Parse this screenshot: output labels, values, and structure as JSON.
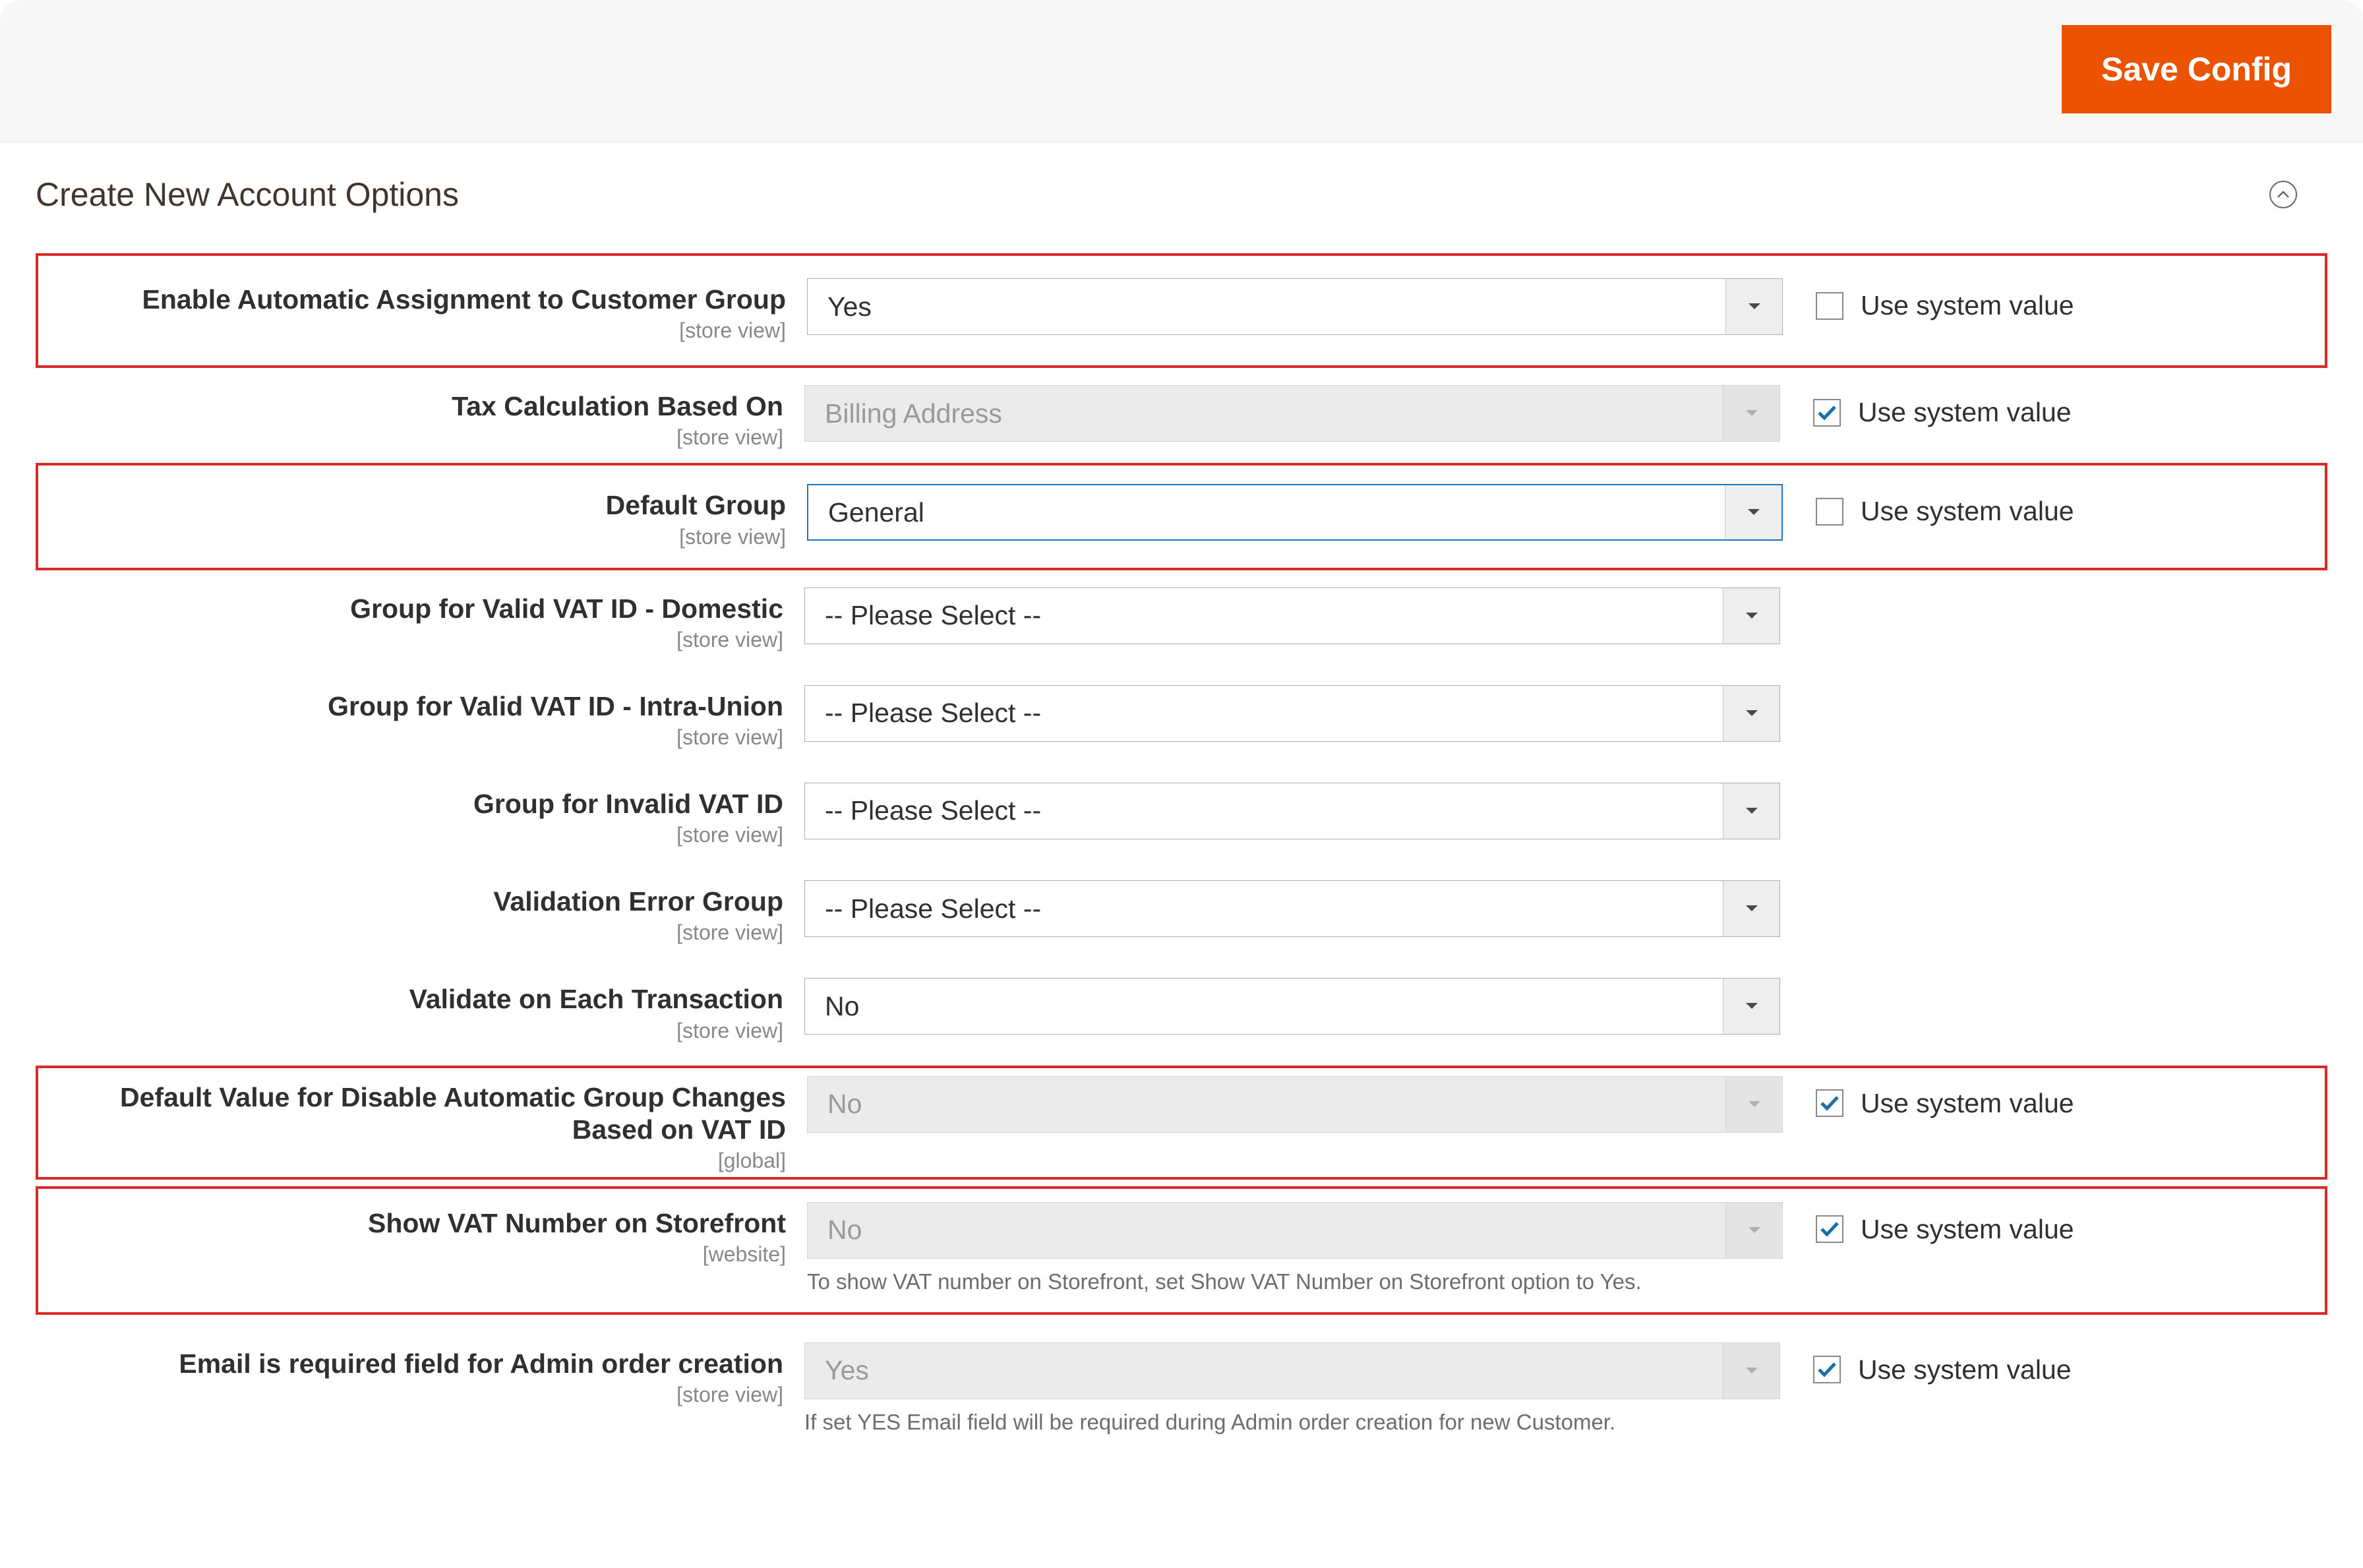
{
  "header": {
    "save_config": "Save Config"
  },
  "section": {
    "title": "Create New Account Options"
  },
  "common": {
    "use_system_value": "Use system value"
  },
  "rows": {
    "r0": {
      "label": "Enable Automatic Assignment to Customer Group",
      "scope": "[store view]",
      "value": "Yes",
      "disabled": false,
      "checked": false,
      "highlight": true,
      "blue": false
    },
    "r1": {
      "label": "Tax Calculation Based On",
      "scope": "[store view]",
      "value": "Billing Address",
      "disabled": true,
      "checked": true,
      "highlight": false,
      "blue": false
    },
    "r2": {
      "label": "Default Group",
      "scope": "[store view]",
      "value": "General",
      "disabled": false,
      "checked": false,
      "highlight": true,
      "blue": true
    },
    "r3": {
      "label": "Group for Valid VAT ID - Domestic",
      "scope": "[store view]",
      "value": "-- Please Select --",
      "disabled": false,
      "checked": false,
      "highlight": false,
      "blue": false
    },
    "r4": {
      "label": "Group for Valid VAT ID - Intra-Union",
      "scope": "[store view]",
      "value": "-- Please Select --",
      "disabled": false,
      "checked": false,
      "highlight": false,
      "blue": false
    },
    "r5": {
      "label": "Group for Invalid VAT ID",
      "scope": "[store view]",
      "value": "-- Please Select --",
      "disabled": false,
      "checked": false,
      "highlight": false,
      "blue": false
    },
    "r6": {
      "label": "Validation Error Group",
      "scope": "[store view]",
      "value": "-- Please Select --",
      "disabled": false,
      "checked": false,
      "highlight": false,
      "blue": false
    },
    "r7": {
      "label": "Validate on Each Transaction",
      "scope": "[store view]",
      "value": "No",
      "disabled": false,
      "checked": false,
      "highlight": false,
      "blue": false
    },
    "r8": {
      "label": "Default Value for Disable Automatic Group Changes Based on VAT ID",
      "scope": "[global]",
      "value": "No",
      "disabled": true,
      "checked": true,
      "highlight": true,
      "blue": false
    },
    "r9": {
      "label": "Show VAT Number on Storefront",
      "scope": "[website]",
      "value": "No",
      "disabled": true,
      "checked": true,
      "highlight": true,
      "blue": false,
      "hint": "To show VAT number on Storefront, set Show VAT Number on Storefront option to Yes."
    },
    "r10": {
      "label": "Email is required field for Admin order creation",
      "scope": "[store view]",
      "value": "Yes",
      "disabled": true,
      "checked": true,
      "highlight": false,
      "blue": false,
      "hint": "If set YES Email field will be required during Admin order creation for new Customer."
    }
  }
}
